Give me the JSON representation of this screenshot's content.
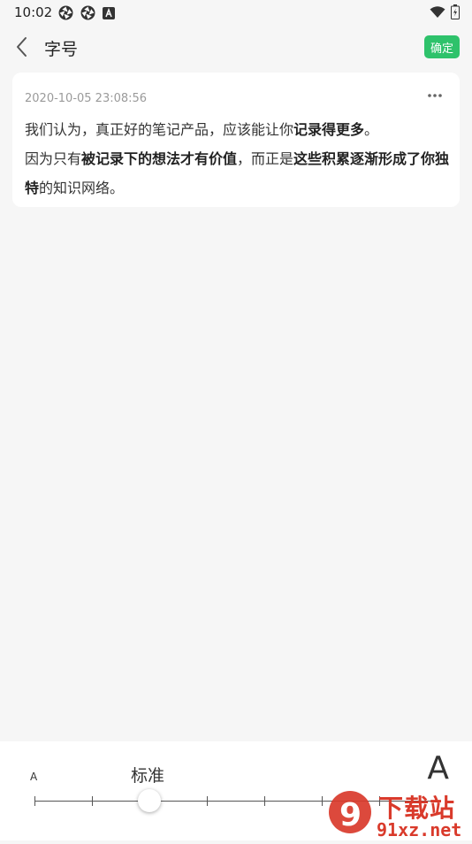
{
  "status": {
    "time": "10:02"
  },
  "header": {
    "title": "字号",
    "confirm_label": "确定"
  },
  "note": {
    "timestamp": "2020-10-05 23:08:56",
    "line1_plain": "我们认为，真正好的笔记产品，应该能让你",
    "line1_bold": "记录得更多",
    "line1_end": "。",
    "line2_plain_a": "因为只有",
    "line2_bold_a": "被记录下的想法才有价值",
    "line2_plain_b": "，而正是",
    "line2_bold_b": "这些积累逐渐形成了你独特",
    "line2_end": "的知识网络。"
  },
  "font_size_panel": {
    "small_label": "A",
    "large_label": "A",
    "current_label": "标准",
    "levels": 7,
    "selected_index": 2
  },
  "watermark": {
    "text_top": "下载站",
    "text_bottom": "91xz.net",
    "color": "#d93a2b"
  },
  "colors": {
    "accent": "#2ec26b"
  }
}
